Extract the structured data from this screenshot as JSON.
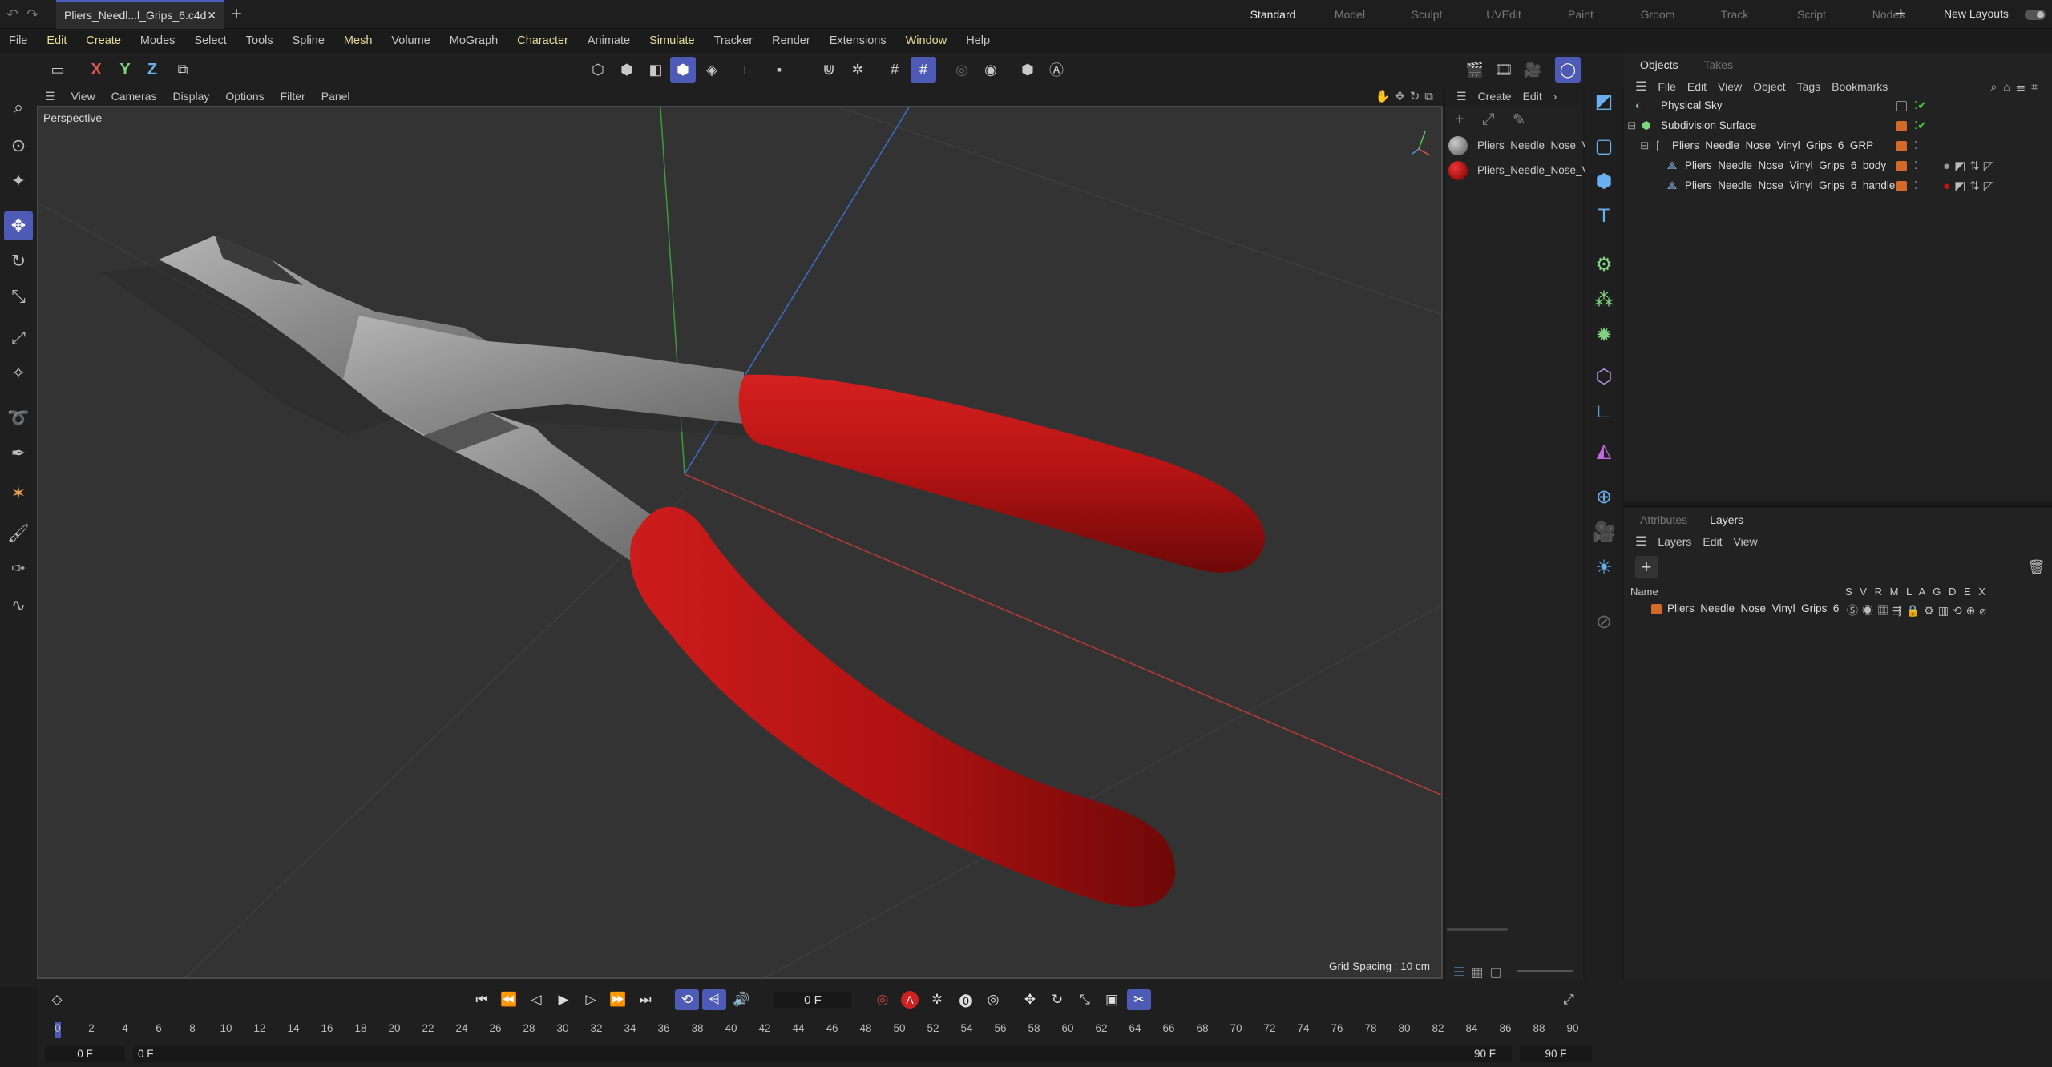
{
  "titlebar": {
    "file_tab": "Pliers_Needl...l_Grips_6.c4d",
    "close": "✕",
    "new_tab": "+",
    "layouts": [
      "Standard",
      "Model",
      "Sculpt",
      "UVEdit",
      "Paint",
      "Groom",
      "Track",
      "Script",
      "Nodes"
    ],
    "active_layout": "Standard",
    "add_layout": "+",
    "new_layouts": "New Layouts"
  },
  "menubar": [
    "File",
    "Edit",
    "Create",
    "Modes",
    "Select",
    "Tools",
    "Spline",
    "Mesh",
    "Volume",
    "MoGraph",
    "Character",
    "Animate",
    "Simulate",
    "Tracker",
    "Render",
    "Extensions",
    "Window",
    "Help"
  ],
  "toolbar": {
    "axis_x": "X",
    "axis_y": "Y",
    "axis_z": "Z"
  },
  "viewport": {
    "menu": [
      "View",
      "Cameras",
      "Display",
      "Options",
      "Filter",
      "Panel"
    ],
    "title": "Perspective",
    "grid_spacing": "Grid Spacing : 10 cm"
  },
  "materials": {
    "menu": [
      "Create",
      "Edit"
    ],
    "items": [
      {
        "label": "Pliers_Needle_Nose_V",
        "color": "#8a8a8a"
      },
      {
        "label": "Pliers_Needle_Nose_V",
        "color": "#b01010"
      }
    ]
  },
  "objects": {
    "tabs": [
      "Objects",
      "Takes"
    ],
    "menu": [
      "File",
      "Edit",
      "View",
      "Object",
      "Tags",
      "Bookmarks"
    ],
    "rows": [
      {
        "name": "Physical Sky",
        "indent": 0
      },
      {
        "name": "Subdivision Surface",
        "indent": 0
      },
      {
        "name": "Pliers_Needle_Nose_Vinyl_Grips_6_GRP",
        "indent": 1
      },
      {
        "name": "Pliers_Needle_Nose_Vinyl_Grips_6_body",
        "indent": 2
      },
      {
        "name": "Pliers_Needle_Nose_Vinyl_Grips_6_handle",
        "indent": 2
      }
    ]
  },
  "layers": {
    "tabs": [
      "Attributes",
      "Layers"
    ],
    "menu": [
      "Layers",
      "Edit",
      "View"
    ],
    "name_header": "Name",
    "flags_header": "S V R M L A G D E X",
    "row": "Pliers_Needle_Nose_Vinyl_Grips_6",
    "accent": "#d46a2a"
  },
  "timeline": {
    "current_frame": "0 F",
    "ticks": [
      "0",
      "2",
      "4",
      "6",
      "8",
      "10",
      "12",
      "14",
      "16",
      "18",
      "20",
      "22",
      "24",
      "26",
      "28",
      "30",
      "32",
      "34",
      "36",
      "38",
      "40",
      "42",
      "44",
      "46",
      "48",
      "50",
      "52",
      "54",
      "56",
      "58",
      "60",
      "62",
      "64",
      "66",
      "68",
      "70",
      "72",
      "74",
      "76",
      "78",
      "80",
      "82",
      "84",
      "86",
      "88",
      "90"
    ],
    "start_a": "0 F",
    "start_b": "0 F",
    "end_a": "90 F",
    "end_b": "90 F"
  },
  "colors": {
    "accent": "#4d5bb6",
    "handle_red": "#b81414",
    "metal": "#8f8f8f"
  }
}
